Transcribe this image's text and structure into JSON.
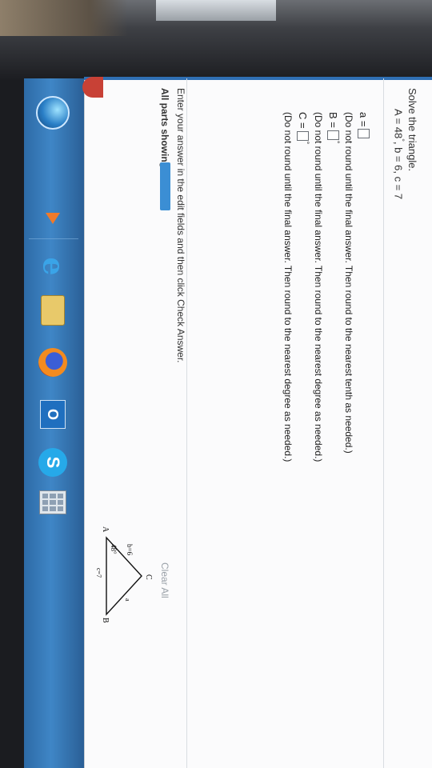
{
  "problem": {
    "prompt": "Solve the triangle.",
    "given": {
      "A": "A = 48",
      "b_c": ", b = 6, c = 7"
    }
  },
  "answers": {
    "a_label": "a =",
    "a_note": "(Do not round until the final answer. Then round to the nearest tenth as needed.)",
    "B_label": "B =",
    "B_note": "(Do not round until the final answer. Then round to the nearest degree as needed.)",
    "C_label": "C =",
    "C_note": "(Do not round until the final answer. Then round to the nearest degree as needed.)",
    "degree_symbol": "°"
  },
  "figure": {
    "vertex_A": "A",
    "vertex_B": "B",
    "vertex_C": "C",
    "side_b": "b=6",
    "side_a": "a",
    "side_c": "c=7",
    "angle_A": "48°"
  },
  "footer": {
    "instruction": "Enter your answer in the edit fields and then click Check Answer.",
    "parts_label": "All parts showing",
    "progress_fraction": 1.0,
    "clear_all": "Clear All"
  },
  "taskbar": {
    "icons": [
      "start-orb-icon",
      "media-player-icon",
      "internet-explorer-icon",
      "file-explorer-icon",
      "firefox-icon",
      "outlook-icon",
      "skype-icon",
      "calculator-icon"
    ]
  },
  "colors": {
    "taskbar": "#3f86c6",
    "progress": "#3b8ed4",
    "page_background": "#fbfbfc"
  }
}
